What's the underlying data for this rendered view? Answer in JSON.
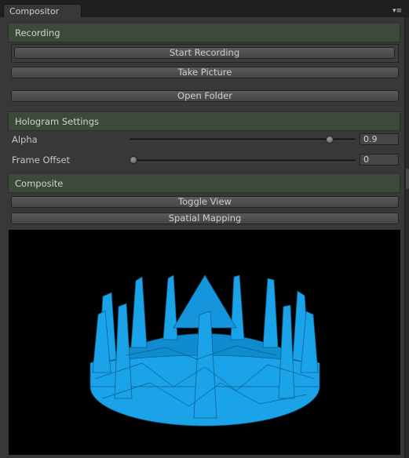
{
  "window": {
    "tab_title": "Compositor"
  },
  "recording": {
    "header": "Recording",
    "start_label": "Start Recording",
    "picture_label": "Take Picture",
    "folder_label": "Open Folder"
  },
  "hologram": {
    "header": "Hologram Settings",
    "alpha": {
      "label": "Alpha",
      "value": "0.9",
      "fraction": 0.9
    },
    "frame_offset": {
      "label": "Frame Offset",
      "value": "0",
      "fraction": 0
    }
  },
  "composite": {
    "header": "Composite",
    "toggle_label": "Toggle View",
    "spatial_label": "Spatial Mapping"
  },
  "colors": {
    "hologram": "#1aa3e8",
    "header_bg": "#3c4a3c",
    "panel_bg": "#383838"
  }
}
